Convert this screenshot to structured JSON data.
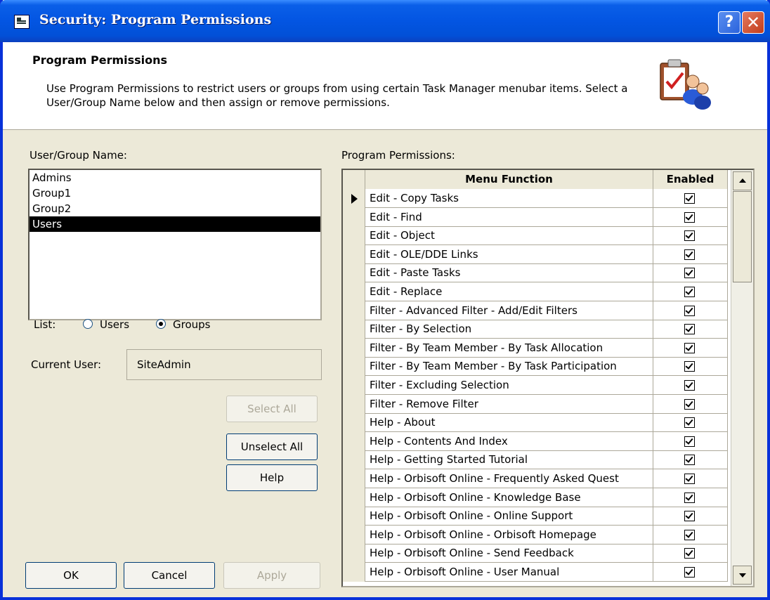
{
  "window": {
    "title": "Security: Program Permissions",
    "help_glyph": "?",
    "close_glyph": "✕",
    "icon": "system-menu-icon"
  },
  "header": {
    "title": "Program Permissions",
    "description": "Use Program Permissions to restrict users or groups from using certain Task Manager menubar items. Select a User/Group Name below and then assign or remove permissions.",
    "graphic": "clipboard-users-icon"
  },
  "left": {
    "group_label": "User/Group Name:",
    "items": [
      {
        "label": "Admins",
        "selected": false
      },
      {
        "label": "Group1",
        "selected": false
      },
      {
        "label": "Group2",
        "selected": false
      },
      {
        "label": "Users",
        "selected": true
      }
    ],
    "list_label": "List:",
    "radio_users": "Users",
    "radio_groups": "Groups",
    "radio_selected": "Groups",
    "current_user_label": "Current User:",
    "current_user_value": "SiteAdmin",
    "select_all": "Select All",
    "unselect_all": "Unselect All",
    "help": "Help"
  },
  "footer": {
    "ok": "OK",
    "cancel": "Cancel",
    "apply": "Apply"
  },
  "permissions": {
    "label": "Program Permissions:",
    "col_function": "Menu Function",
    "col_enabled": "Enabled",
    "rows": [
      {
        "function": "Edit - Copy Tasks",
        "enabled": true
      },
      {
        "function": "Edit - Find",
        "enabled": true
      },
      {
        "function": "Edit - Object",
        "enabled": true
      },
      {
        "function": "Edit - OLE/DDE Links",
        "enabled": true
      },
      {
        "function": "Edit - Paste Tasks",
        "enabled": true
      },
      {
        "function": "Edit - Replace",
        "enabled": true
      },
      {
        "function": "Filter - Advanced Filter - Add/Edit Filters",
        "enabled": true
      },
      {
        "function": "Filter - By Selection",
        "enabled": true
      },
      {
        "function": "Filter - By Team Member - By Task Allocation",
        "enabled": true
      },
      {
        "function": "Filter - By Team Member - By Task Participation",
        "enabled": true
      },
      {
        "function": "Filter - Excluding Selection",
        "enabled": true
      },
      {
        "function": "Filter - Remove Filter",
        "enabled": true
      },
      {
        "function": "Help - About",
        "enabled": true
      },
      {
        "function": "Help - Contents And Index",
        "enabled": true
      },
      {
        "function": "Help - Getting Started Tutorial",
        "enabled": true
      },
      {
        "function": "Help - Orbisoft Online - Frequently Asked Quest",
        "enabled": true
      },
      {
        "function": "Help - Orbisoft Online - Knowledge Base",
        "enabled": true
      },
      {
        "function": "Help - Orbisoft Online - Online Support",
        "enabled": true
      },
      {
        "function": "Help - Orbisoft Online - Orbisoft Homepage",
        "enabled": true
      },
      {
        "function": "Help - Orbisoft Online - Send Feedback",
        "enabled": true
      },
      {
        "function": "Help - Orbisoft Online - User Manual",
        "enabled": true
      }
    ]
  },
  "colors": {
    "titlebar": "#0355e2",
    "dialog": "#ece9d8",
    "selection": "#000000"
  }
}
